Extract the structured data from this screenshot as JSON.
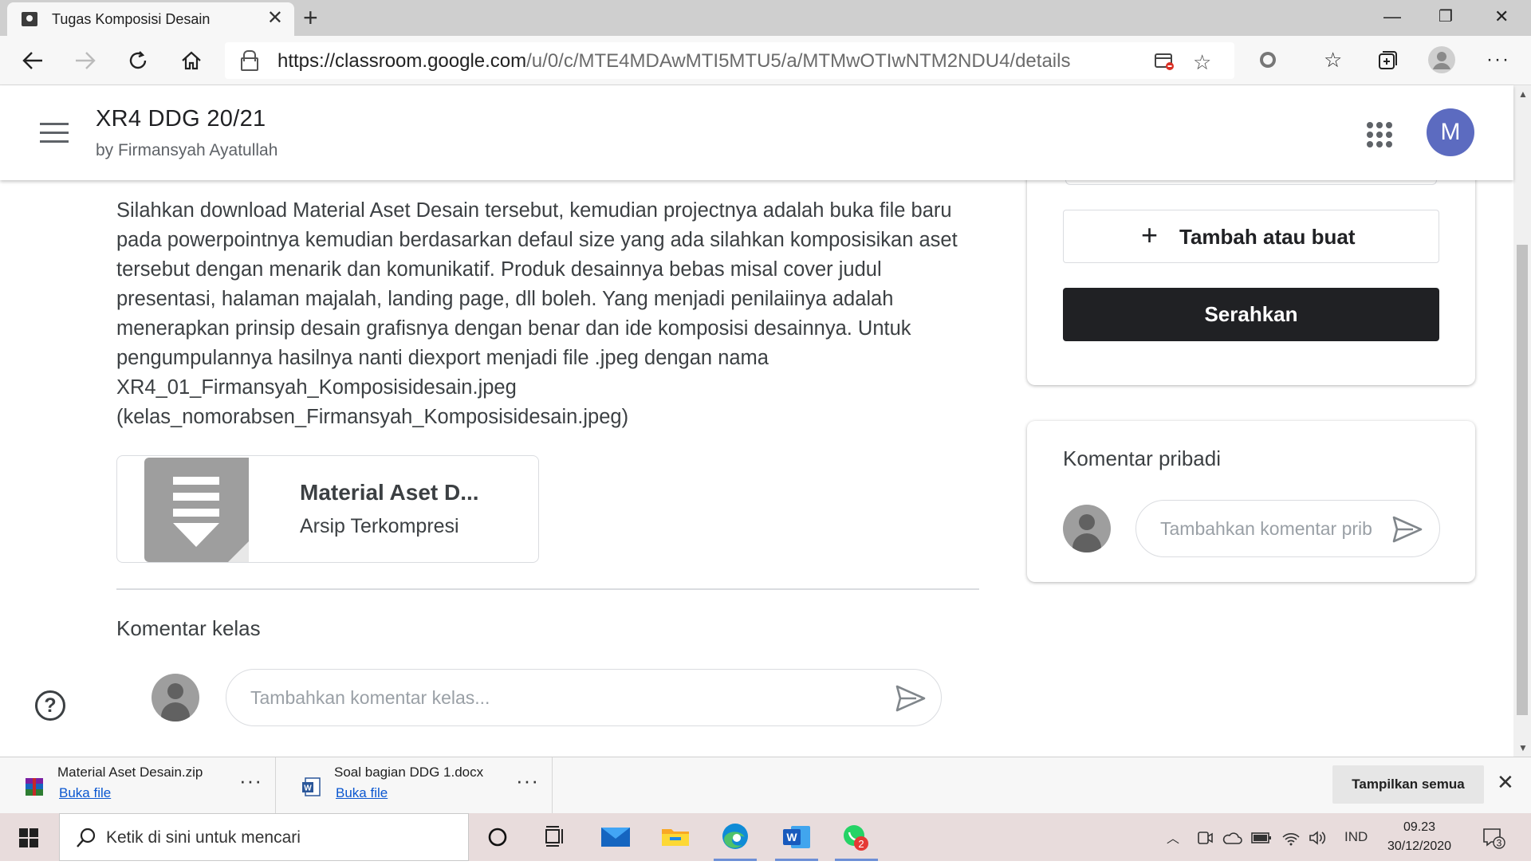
{
  "browser": {
    "tab_title": "Tugas Komposisi Desain",
    "url_host": "https://classroom.google.com",
    "url_path": "/u/0/c/MTE4MDAwMTI5MTU5/a/MTMwOTIwNTM2NDU4/details"
  },
  "header": {
    "class_name": "XR4 DDG 20/21",
    "teacher": "by Firmansyah Ayatullah",
    "avatar_letter": "M",
    "avatar_color": "#5c6bc0"
  },
  "assignment": {
    "description": "Silahkan download Material Aset Desain tersebut, kemudian projectnya adalah buka file baru pada powerpointnya kemudian berdasarkan defaul size yang ada silahkan komposisikan aset tersebut dengan menarik dan komunikatif. Produk desainnya bebas misal cover judul presentasi, halaman majalah, landing page, dll boleh. Yang menjadi penilaiinya adalah menerapkan prinsip desain grafisnya dengan benar dan ide komposisi desainnya. Untuk pengumpulannya hasilnya nanti diexport menjadi file .jpeg dengan nama XR4_01_Firmansyah_Komposisidesain.jpeg (kelas_nomorabsen_Firmansyah_Komposisidesain.jpeg)",
    "attachment_name": "Material Aset D...",
    "attachment_type": "Arsip Terkompresi"
  },
  "class_comments": {
    "title": "Komentar kelas",
    "placeholder": "Tambahkan komentar kelas..."
  },
  "your_work": {
    "add_label": "Tambah atau buat",
    "submit_label": "Serahkan"
  },
  "private_comments": {
    "title": "Komentar pribadi",
    "placeholder": "Tambahkan komentar pribadi..."
  },
  "downloads": {
    "items": [
      {
        "name": "Material Aset Desain.zip",
        "action": "Buka file",
        "icon": "winrar-icon"
      },
      {
        "name": "Soal bagian DDG 1.docx",
        "action": "Buka file",
        "icon": "word-doc-icon"
      }
    ],
    "show_all": "Tampilkan semua"
  },
  "taskbar": {
    "search_placeholder": "Ketik di sini untuk mencari",
    "language": "IND",
    "time": "09.23",
    "date": "30/12/2020",
    "whatsapp_badge": "2",
    "notification_count": "3"
  }
}
